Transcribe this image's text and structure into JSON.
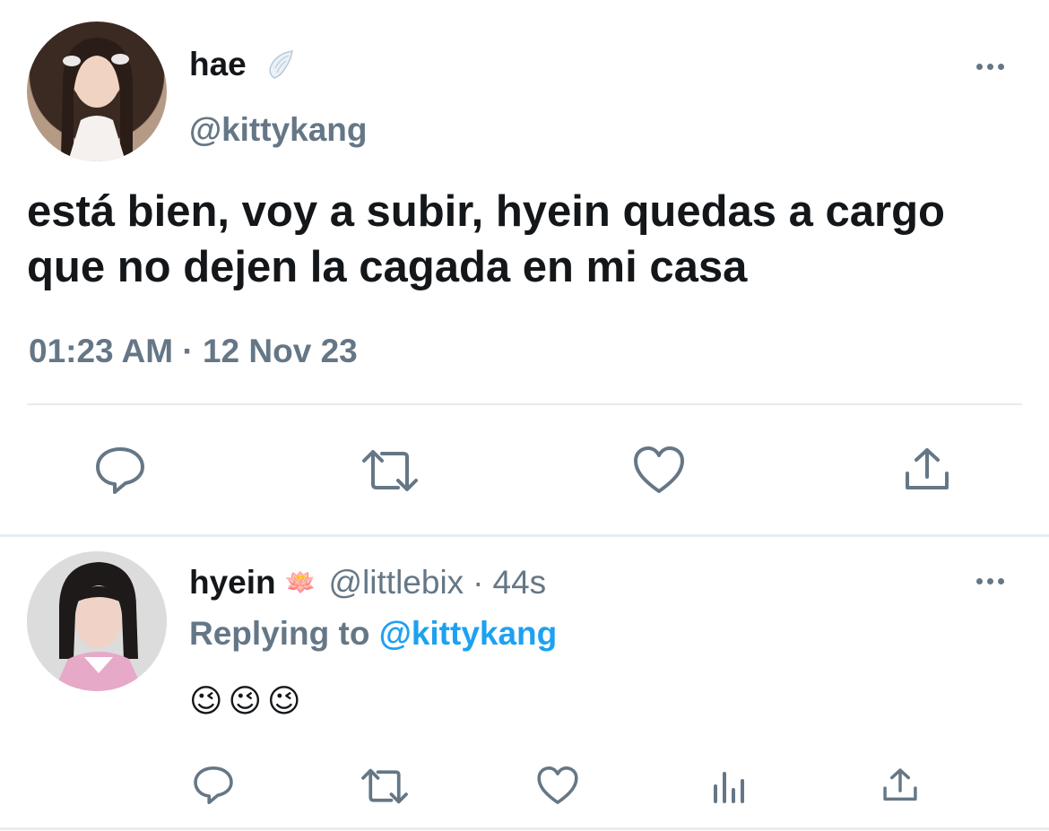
{
  "main_tweet": {
    "display_name": "hae",
    "name_badge_icon": "angel-wing-icon",
    "handle": "@kittykang",
    "text": "está bien, voy a subir, hyein quedas a cargo que no dejen la cagada en mi casa",
    "timestamp": "01:23 AM · 12 Nov 23",
    "actions": [
      "reply-icon",
      "retweet-icon",
      "like-icon",
      "share-icon"
    ]
  },
  "reply_tweet": {
    "display_name": "hyein",
    "name_emoji": "🪷",
    "handle": "@littlebix",
    "separator": "·",
    "time_ago": "44s",
    "replying_label": "Replying to",
    "replying_to": "@kittykang",
    "text": "😉😉😉",
    "actions": [
      "reply-icon",
      "retweet-icon",
      "like-icon",
      "analytics-icon",
      "share-icon"
    ]
  },
  "colors": {
    "text_primary": "#14171a",
    "text_muted": "#657786",
    "link": "#1da1f2",
    "divider": "#e6ecf0"
  }
}
